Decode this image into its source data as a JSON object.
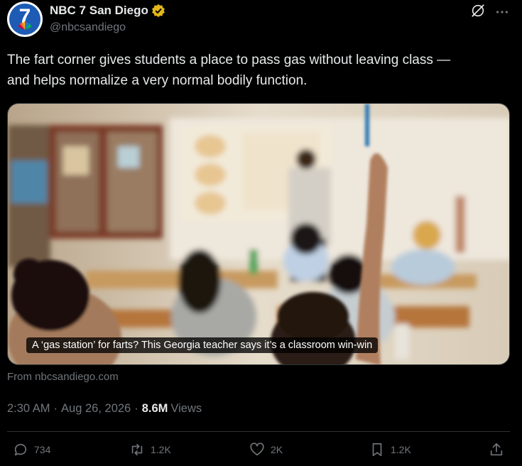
{
  "account": {
    "display_name": "NBC 7 San Diego",
    "handle": "@nbcsandiego",
    "avatar_text": "7",
    "verified": true
  },
  "tweet": {
    "text_line1": "The fart corner gives students a place to pass gas without leaving class —",
    "text_line2": "and helps normalize a very normal bodily function."
  },
  "media": {
    "caption": "A ‘gas station’ for farts? This Georgia teacher says it’s a classroom win-win",
    "source": "From nbcsandiego.com"
  },
  "meta": {
    "time": "2:30 AM",
    "separator": "·",
    "date": "Aug 26, 2026",
    "views_count": "8.6M",
    "views_label": "Views"
  },
  "actions": {
    "replies": "734",
    "reposts": "1.2K",
    "likes": "2K",
    "bookmarks": "1.2K"
  },
  "icons": {
    "verified": "verified-badge-icon",
    "grok": "grok-icon",
    "more": "more-icon",
    "reply": "reply-icon",
    "repost": "repost-icon",
    "like": "heart-icon",
    "bookmark": "bookmark-icon",
    "share": "share-icon"
  },
  "colors": {
    "background": "#000000",
    "text": "#e7e9ea",
    "muted": "#71767b",
    "verified_gold": "#e2b719",
    "avatar_blue": "#1d5bb5"
  }
}
